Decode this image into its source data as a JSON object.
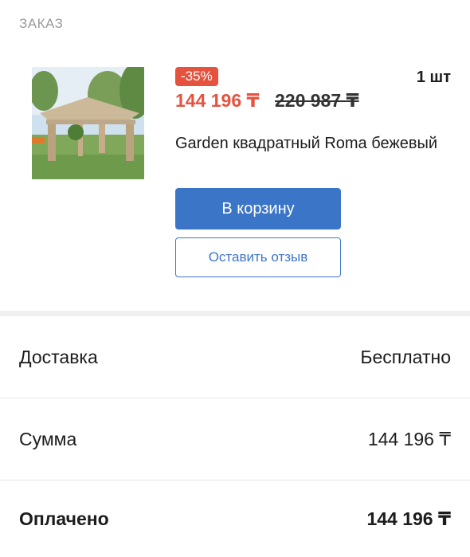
{
  "order": {
    "section_label": "ЗАКАЗ",
    "item": {
      "image_alt": "Garden квадратный Roma бежевый",
      "discount": "-35%",
      "price_current": "144 196 ₸",
      "price_old": "220 987 ₸",
      "quantity": "1 шт",
      "title": "Garden квадратный Roma бежевый",
      "add_to_cart_label": "В корзину",
      "leave_review_label": "Оставить отзыв"
    }
  },
  "summary": {
    "delivery_label": "Доставка",
    "delivery_value": "Бесплатно",
    "sum_label": "Сумма",
    "sum_value": "144 196 ₸",
    "paid_label": "Оплачено",
    "paid_value": "144 196 ₸"
  },
  "colors": {
    "accent_blue": "#3b75c8",
    "discount_red": "#e5533f"
  }
}
